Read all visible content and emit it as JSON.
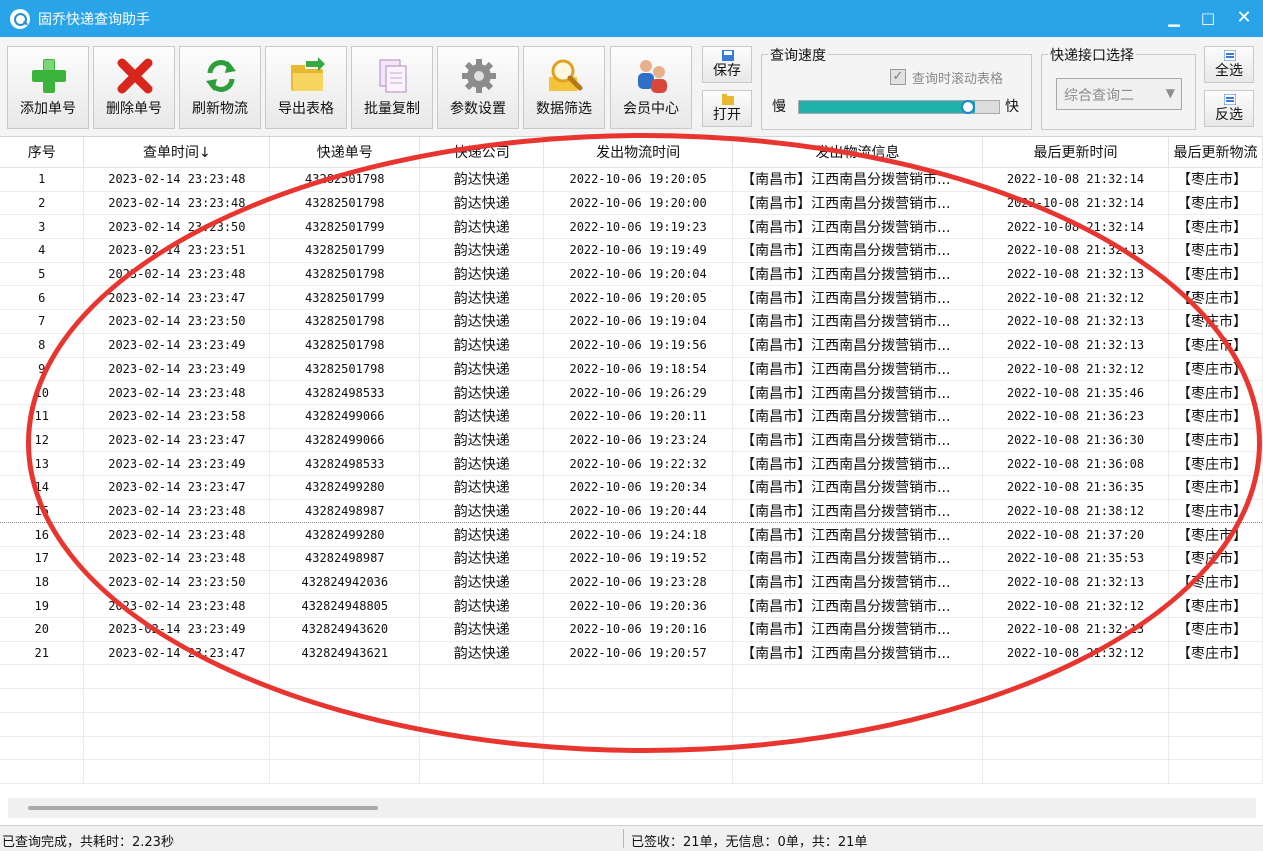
{
  "window": {
    "title": "固乔快递查询助手",
    "minimize": "▁",
    "maximize": "□",
    "close": "✕"
  },
  "toolbar": {
    "buttons": [
      {
        "label": "添加单号",
        "icon": "add-icon"
      },
      {
        "label": "删除单号",
        "icon": "delete-icon"
      },
      {
        "label": "刷新物流",
        "icon": "refresh-icon"
      },
      {
        "label": "导出表格",
        "icon": "export-folder-icon"
      },
      {
        "label": "批量复制",
        "icon": "copy-icon"
      },
      {
        "label": "参数设置",
        "icon": "gear-icon"
      },
      {
        "label": "数据筛选",
        "icon": "magnifier-icon"
      },
      {
        "label": "会员中心",
        "icon": "members-icon"
      }
    ],
    "save_label": "保存",
    "open_label": "打开",
    "speed": {
      "label": "查询速度",
      "scroll_label": "查询时滚动表格",
      "scroll_checked": true,
      "slow": "慢",
      "fast": "快",
      "level": 0.88,
      "fill_color": "#20b2aa"
    },
    "api": {
      "label": "快递接口选择",
      "value": "综合查询二"
    },
    "select_all_label": "全选",
    "invert_label": "反选"
  },
  "table": {
    "columns": [
      "序号",
      "查单时间↓",
      "快递单号",
      "快递公司",
      "发出物流时间",
      "发出物流信息",
      "最后更新时间",
      "最后更新物流"
    ],
    "rows": [
      [
        "1",
        "2023-02-14 23:23:48",
        "43282501798",
        "韵达快递",
        "2022-10-06 19:20:05",
        "【南昌市】江西南昌分拨营销市...",
        "2022-10-08 21:32:14",
        "【枣庄市】"
      ],
      [
        "2",
        "2023-02-14 23:23:48",
        "43282501798",
        "韵达快递",
        "2022-10-06 19:20:00",
        "【南昌市】江西南昌分拨营销市...",
        "2022-10-08 21:32:14",
        "【枣庄市】"
      ],
      [
        "3",
        "2023-02-14 23:23:50",
        "43282501799",
        "韵达快递",
        "2022-10-06 19:19:23",
        "【南昌市】江西南昌分拨营销市...",
        "2022-10-08 21:32:14",
        "【枣庄市】"
      ],
      [
        "4",
        "2023-02-14 23:23:51",
        "43282501799",
        "韵达快递",
        "2022-10-06 19:19:49",
        "【南昌市】江西南昌分拨营销市...",
        "2022-10-08 21:32:13",
        "【枣庄市】"
      ],
      [
        "5",
        "2023-02-14 23:23:48",
        "43282501798",
        "韵达快递",
        "2022-10-06 19:20:04",
        "【南昌市】江西南昌分拨营销市...",
        "2022-10-08 21:32:13",
        "【枣庄市】"
      ],
      [
        "6",
        "2023-02-14 23:23:47",
        "43282501799",
        "韵达快递",
        "2022-10-06 19:20:05",
        "【南昌市】江西南昌分拨营销市...",
        "2022-10-08 21:32:12",
        "【枣庄市】"
      ],
      [
        "7",
        "2023-02-14 23:23:50",
        "43282501798",
        "韵达快递",
        "2022-10-06 19:19:04",
        "【南昌市】江西南昌分拨营销市...",
        "2022-10-08 21:32:13",
        "【枣庄市】"
      ],
      [
        "8",
        "2023-02-14 23:23:49",
        "43282501798",
        "韵达快递",
        "2022-10-06 19:19:56",
        "【南昌市】江西南昌分拨营销市...",
        "2022-10-08 21:32:13",
        "【枣庄市】"
      ],
      [
        "9",
        "2023-02-14 23:23:49",
        "43282501798",
        "韵达快递",
        "2022-10-06 19:18:54",
        "【南昌市】江西南昌分拨营销市...",
        "2022-10-08 21:32:12",
        "【枣庄市】"
      ],
      [
        "10",
        "2023-02-14 23:23:48",
        "43282498533",
        "韵达快递",
        "2022-10-06 19:26:29",
        "【南昌市】江西南昌分拨营销市...",
        "2022-10-08 21:35:46",
        "【枣庄市】"
      ],
      [
        "11",
        "2023-02-14 23:23:58",
        "43282499066",
        "韵达快递",
        "2022-10-06 19:20:11",
        "【南昌市】江西南昌分拨营销市...",
        "2022-10-08 21:36:23",
        "【枣庄市】"
      ],
      [
        "12",
        "2023-02-14 23:23:47",
        "43282499066",
        "韵达快递",
        "2022-10-06 19:23:24",
        "【南昌市】江西南昌分拨营销市...",
        "2022-10-08 21:36:30",
        "【枣庄市】"
      ],
      [
        "13",
        "2023-02-14 23:23:49",
        "43282498533",
        "韵达快递",
        "2022-10-06 19:22:32",
        "【南昌市】江西南昌分拨营销市...",
        "2022-10-08 21:36:08",
        "【枣庄市】"
      ],
      [
        "14",
        "2023-02-14 23:23:47",
        "43282499280",
        "韵达快递",
        "2022-10-06 19:20:34",
        "【南昌市】江西南昌分拨营销市...",
        "2022-10-08 21:36:35",
        "【枣庄市】"
      ],
      [
        "15",
        "2023-02-14 23:23:48",
        "43282498987",
        "韵达快递",
        "2022-10-06 19:20:44",
        "【南昌市】江西南昌分拨营销市...",
        "2022-10-08 21:38:12",
        "【枣庄市】"
      ],
      [
        "16",
        "2023-02-14 23:23:48",
        "43282499280",
        "韵达快递",
        "2022-10-06 19:24:18",
        "【南昌市】江西南昌分拨营销市...",
        "2022-10-08 21:37:20",
        "【枣庄市】"
      ],
      [
        "17",
        "2023-02-14 23:23:48",
        "43282498987",
        "韵达快递",
        "2022-10-06 19:19:52",
        "【南昌市】江西南昌分拨营销市...",
        "2022-10-08 21:35:53",
        "【枣庄市】"
      ],
      [
        "18",
        "2023-02-14 23:23:50",
        "432824942036",
        "韵达快递",
        "2022-10-06 19:23:28",
        "【南昌市】江西南昌分拨营销市...",
        "2022-10-08 21:32:13",
        "【枣庄市】"
      ],
      [
        "19",
        "2023-02-14 23:23:48",
        "432824948805",
        "韵达快递",
        "2022-10-06 19:20:36",
        "【南昌市】江西南昌分拨营销市...",
        "2022-10-08 21:32:12",
        "【枣庄市】"
      ],
      [
        "20",
        "2023-02-14 23:23:49",
        "432824943620",
        "韵达快递",
        "2022-10-06 19:20:16",
        "【南昌市】江西南昌分拨营销市...",
        "2022-10-08 21:32:13",
        "【枣庄市】"
      ],
      [
        "21",
        "2023-02-14 23:23:47",
        "432824943621",
        "韵达快递",
        "2022-10-06 19:20:57",
        "【南昌市】江西南昌分拨营销市...",
        "2022-10-08 21:32:12",
        "【枣庄市】"
      ]
    ],
    "empty_rows": 5
  },
  "status": {
    "left": "已查询完成，共耗时：2.23秒",
    "right": "已签收：21单，无信息：0单，共：21单"
  },
  "annotation": {
    "color": "#e8352f"
  }
}
